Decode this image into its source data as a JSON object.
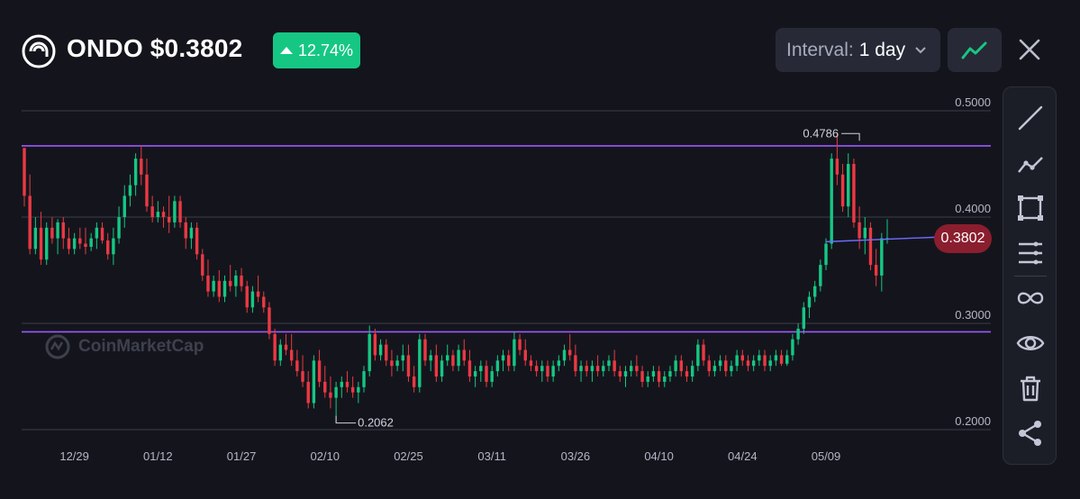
{
  "header": {
    "ticker_price": "ONDO $0.3802",
    "change": "12.74%",
    "interval_label": "Interval:",
    "interval_value": "1 day"
  },
  "current_price_label": "0.3802",
  "watermark": "CoinMarketCap",
  "colors": {
    "up": "#16c784",
    "down": "#ea3943",
    "level_line": "#9b59ff",
    "price_line": "#6f6bff",
    "price_badge": "#8b1e2e"
  },
  "toolbar": [
    "trend-line-icon",
    "polyline-icon",
    "rectangle-icon",
    "horizontal-lines-icon",
    "infinity-icon",
    "eye-icon",
    "trash-icon",
    "share-icon"
  ],
  "chart_data": {
    "type": "candlestick",
    "y_ticks": [
      "0.5000",
      "0.4000",
      "0.3000",
      "0.2000"
    ],
    "ylim": [
      0.2,
      0.5
    ],
    "x_ticks": [
      "12/29",
      "01/12",
      "01/27",
      "02/10",
      "02/25",
      "03/11",
      "03/26",
      "04/10",
      "04/24",
      "05/09"
    ],
    "x_tick_index": [
      9,
      24,
      39,
      54,
      69,
      84,
      99,
      114,
      129,
      144
    ],
    "annotations": [
      {
        "label": "0.4786",
        "index": 150,
        "value": 0.4786
      },
      {
        "label": "0.2062",
        "index": 56,
        "value": 0.2062
      }
    ],
    "horizontal_levels": [
      0.467,
      0.292
    ],
    "current_price": 0.3802,
    "candles": [
      [
        0.465,
        0.465,
        0.41,
        0.42
      ],
      [
        0.42,
        0.44,
        0.365,
        0.37
      ],
      [
        0.37,
        0.4,
        0.365,
        0.39
      ],
      [
        0.39,
        0.405,
        0.355,
        0.36
      ],
      [
        0.36,
        0.395,
        0.355,
        0.39
      ],
      [
        0.39,
        0.4,
        0.375,
        0.38
      ],
      [
        0.38,
        0.398,
        0.365,
        0.395
      ],
      [
        0.395,
        0.4,
        0.37,
        0.38
      ],
      [
        0.38,
        0.39,
        0.365,
        0.37
      ],
      [
        0.37,
        0.385,
        0.365,
        0.38
      ],
      [
        0.38,
        0.39,
        0.37,
        0.375
      ],
      [
        0.375,
        0.39,
        0.365,
        0.372
      ],
      [
        0.372,
        0.385,
        0.368,
        0.38
      ],
      [
        0.38,
        0.395,
        0.37,
        0.39
      ],
      [
        0.39,
        0.395,
        0.375,
        0.378
      ],
      [
        0.378,
        0.385,
        0.36,
        0.365
      ],
      [
        0.365,
        0.39,
        0.355,
        0.38
      ],
      [
        0.38,
        0.41,
        0.375,
        0.4
      ],
      [
        0.4,
        0.43,
        0.39,
        0.42
      ],
      [
        0.42,
        0.44,
        0.41,
        0.43
      ],
      [
        0.43,
        0.46,
        0.42,
        0.455
      ],
      [
        0.455,
        0.4675,
        0.43,
        0.44
      ],
      [
        0.44,
        0.455,
        0.405,
        0.41
      ],
      [
        0.41,
        0.42,
        0.395,
        0.4
      ],
      [
        0.4,
        0.415,
        0.395,
        0.405
      ],
      [
        0.405,
        0.41,
        0.39,
        0.4
      ],
      [
        0.4,
        0.42,
        0.385,
        0.395
      ],
      [
        0.395,
        0.42,
        0.39,
        0.415
      ],
      [
        0.415,
        0.42,
        0.39,
        0.395
      ],
      [
        0.395,
        0.4,
        0.37,
        0.38
      ],
      [
        0.38,
        0.395,
        0.37,
        0.39
      ],
      [
        0.39,
        0.395,
        0.36,
        0.365
      ],
      [
        0.365,
        0.37,
        0.34,
        0.345
      ],
      [
        0.345,
        0.36,
        0.325,
        0.33
      ],
      [
        0.33,
        0.345,
        0.325,
        0.34
      ],
      [
        0.34,
        0.35,
        0.32,
        0.325
      ],
      [
        0.325,
        0.345,
        0.32,
        0.34
      ],
      [
        0.34,
        0.355,
        0.33,
        0.335
      ],
      [
        0.335,
        0.35,
        0.325,
        0.345
      ],
      [
        0.345,
        0.352,
        0.33,
        0.335
      ],
      [
        0.335,
        0.34,
        0.31,
        0.315
      ],
      [
        0.315,
        0.335,
        0.31,
        0.33
      ],
      [
        0.33,
        0.345,
        0.32,
        0.325
      ],
      [
        0.325,
        0.33,
        0.31,
        0.315
      ],
      [
        0.315,
        0.32,
        0.285,
        0.29
      ],
      [
        0.29,
        0.295,
        0.26,
        0.265
      ],
      [
        0.265,
        0.285,
        0.26,
        0.28
      ],
      [
        0.28,
        0.29,
        0.27,
        0.275
      ],
      [
        0.275,
        0.29,
        0.26,
        0.265
      ],
      [
        0.265,
        0.275,
        0.25,
        0.255
      ],
      [
        0.255,
        0.27,
        0.24,
        0.245
      ],
      [
        0.245,
        0.255,
        0.22,
        0.225
      ],
      [
        0.225,
        0.27,
        0.22,
        0.265
      ],
      [
        0.265,
        0.275,
        0.24,
        0.245
      ],
      [
        0.245,
        0.26,
        0.23,
        0.235
      ],
      [
        0.235,
        0.25,
        0.22,
        0.23
      ],
      [
        0.23,
        0.245,
        0.2062,
        0.24
      ],
      [
        0.24,
        0.25,
        0.23,
        0.245
      ],
      [
        0.245,
        0.255,
        0.235,
        0.24
      ],
      [
        0.24,
        0.25,
        0.23,
        0.235
      ],
      [
        0.235,
        0.245,
        0.225,
        0.24
      ],
      [
        0.24,
        0.26,
        0.235,
        0.255
      ],
      [
        0.255,
        0.298,
        0.25,
        0.29
      ],
      [
        0.29,
        0.295,
        0.265,
        0.27
      ],
      [
        0.27,
        0.285,
        0.265,
        0.28
      ],
      [
        0.28,
        0.285,
        0.26,
        0.265
      ],
      [
        0.265,
        0.275,
        0.25,
        0.26
      ],
      [
        0.26,
        0.27,
        0.255,
        0.265
      ],
      [
        0.265,
        0.28,
        0.255,
        0.27
      ],
      [
        0.27,
        0.28,
        0.245,
        0.25
      ],
      [
        0.25,
        0.26,
        0.235,
        0.24
      ],
      [
        0.24,
        0.29,
        0.235,
        0.285
      ],
      [
        0.285,
        0.29,
        0.26,
        0.265
      ],
      [
        0.265,
        0.275,
        0.255,
        0.27
      ],
      [
        0.27,
        0.28,
        0.245,
        0.25
      ],
      [
        0.25,
        0.27,
        0.245,
        0.265
      ],
      [
        0.265,
        0.28,
        0.26,
        0.27
      ],
      [
        0.27,
        0.275,
        0.255,
        0.26
      ],
      [
        0.26,
        0.28,
        0.255,
        0.275
      ],
      [
        0.275,
        0.285,
        0.26,
        0.265
      ],
      [
        0.265,
        0.275,
        0.245,
        0.25
      ],
      [
        0.25,
        0.26,
        0.24,
        0.255
      ],
      [
        0.255,
        0.265,
        0.245,
        0.26
      ],
      [
        0.26,
        0.265,
        0.24,
        0.245
      ],
      [
        0.245,
        0.26,
        0.24,
        0.255
      ],
      [
        0.255,
        0.27,
        0.25,
        0.265
      ],
      [
        0.265,
        0.275,
        0.255,
        0.27
      ],
      [
        0.27,
        0.275,
        0.255,
        0.26
      ],
      [
        0.26,
        0.292,
        0.255,
        0.285
      ],
      [
        0.285,
        0.29,
        0.27,
        0.275
      ],
      [
        0.275,
        0.285,
        0.26,
        0.265
      ],
      [
        0.265,
        0.27,
        0.255,
        0.26
      ],
      [
        0.26,
        0.265,
        0.25,
        0.255
      ],
      [
        0.255,
        0.265,
        0.245,
        0.26
      ],
      [
        0.26,
        0.265,
        0.245,
        0.25
      ],
      [
        0.25,
        0.265,
        0.245,
        0.26
      ],
      [
        0.26,
        0.27,
        0.255,
        0.265
      ],
      [
        0.265,
        0.28,
        0.26,
        0.275
      ],
      [
        0.275,
        0.29,
        0.265,
        0.27
      ],
      [
        0.27,
        0.28,
        0.25,
        0.255
      ],
      [
        0.255,
        0.265,
        0.245,
        0.26
      ],
      [
        0.26,
        0.265,
        0.25,
        0.255
      ],
      [
        0.255,
        0.265,
        0.245,
        0.26
      ],
      [
        0.26,
        0.27,
        0.25,
        0.255
      ],
      [
        0.255,
        0.265,
        0.25,
        0.26
      ],
      [
        0.26,
        0.27,
        0.255,
        0.265
      ],
      [
        0.265,
        0.275,
        0.25,
        0.255
      ],
      [
        0.255,
        0.26,
        0.245,
        0.25
      ],
      [
        0.25,
        0.26,
        0.24,
        0.255
      ],
      [
        0.255,
        0.265,
        0.25,
        0.26
      ],
      [
        0.26,
        0.27,
        0.25,
        0.255
      ],
      [
        0.255,
        0.26,
        0.24,
        0.245
      ],
      [
        0.245,
        0.255,
        0.24,
        0.25
      ],
      [
        0.25,
        0.26,
        0.245,
        0.255
      ],
      [
        0.255,
        0.26,
        0.24,
        0.245
      ],
      [
        0.245,
        0.255,
        0.24,
        0.25
      ],
      [
        0.25,
        0.26,
        0.245,
        0.255
      ],
      [
        0.255,
        0.27,
        0.25,
        0.265
      ],
      [
        0.265,
        0.27,
        0.25,
        0.255
      ],
      [
        0.255,
        0.26,
        0.245,
        0.25
      ],
      [
        0.25,
        0.265,
        0.245,
        0.26
      ],
      [
        0.26,
        0.285,
        0.255,
        0.28
      ],
      [
        0.28,
        0.285,
        0.26,
        0.265
      ],
      [
        0.265,
        0.27,
        0.25,
        0.255
      ],
      [
        0.255,
        0.265,
        0.25,
        0.26
      ],
      [
        0.26,
        0.27,
        0.255,
        0.265
      ],
      [
        0.265,
        0.27,
        0.25,
        0.255
      ],
      [
        0.255,
        0.265,
        0.25,
        0.26
      ],
      [
        0.26,
        0.275,
        0.255,
        0.27
      ],
      [
        0.27,
        0.275,
        0.26,
        0.265
      ],
      [
        0.265,
        0.27,
        0.255,
        0.26
      ],
      [
        0.26,
        0.27,
        0.255,
        0.265
      ],
      [
        0.265,
        0.275,
        0.26,
        0.27
      ],
      [
        0.27,
        0.275,
        0.255,
        0.26
      ],
      [
        0.26,
        0.27,
        0.255,
        0.265
      ],
      [
        0.265,
        0.275,
        0.26,
        0.27
      ],
      [
        0.27,
        0.275,
        0.26,
        0.262
      ],
      [
        0.262,
        0.275,
        0.26,
        0.27
      ],
      [
        0.27,
        0.29,
        0.265,
        0.285
      ],
      [
        0.285,
        0.3,
        0.28,
        0.295
      ],
      [
        0.295,
        0.32,
        0.29,
        0.315
      ],
      [
        0.315,
        0.33,
        0.305,
        0.325
      ],
      [
        0.325,
        0.34,
        0.32,
        0.335
      ],
      [
        0.335,
        0.36,
        0.33,
        0.355
      ],
      [
        0.355,
        0.38,
        0.35,
        0.375
      ],
      [
        0.375,
        0.46,
        0.37,
        0.455
      ],
      [
        0.455,
        0.4786,
        0.43,
        0.44
      ],
      [
        0.44,
        0.45,
        0.405,
        0.41
      ],
      [
        0.41,
        0.46,
        0.4,
        0.45
      ],
      [
        0.45,
        0.455,
        0.39,
        0.395
      ],
      [
        0.395,
        0.41,
        0.37,
        0.38
      ],
      [
        0.38,
        0.4,
        0.365,
        0.39
      ],
      [
        0.39,
        0.395,
        0.35,
        0.355
      ],
      [
        0.355,
        0.37,
        0.335,
        0.345
      ],
      [
        0.345,
        0.385,
        0.33,
        0.38
      ],
      [
        0.38,
        0.398,
        0.375,
        0.3802
      ]
    ]
  }
}
